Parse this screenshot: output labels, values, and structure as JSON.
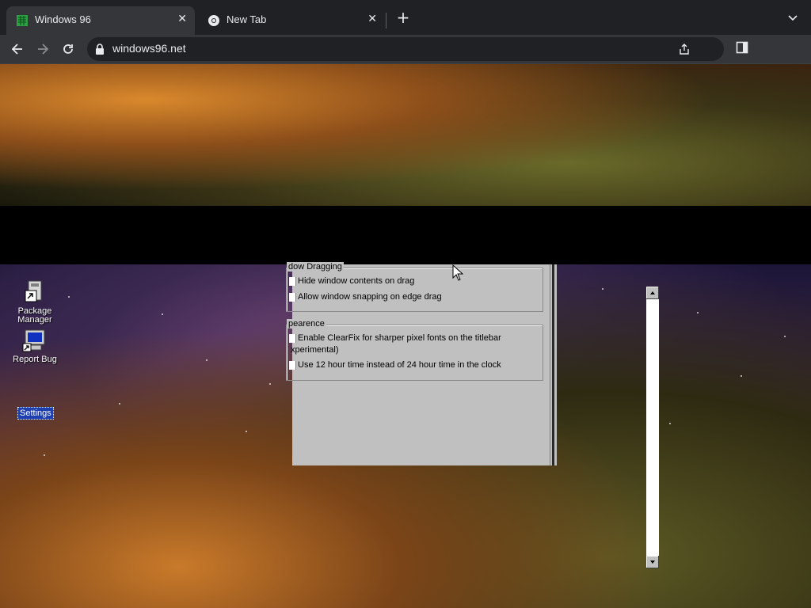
{
  "browser": {
    "tabs": [
      {
        "title": "Windows 96",
        "active": true,
        "favicon": "windows96-icon"
      },
      {
        "title": "New Tab",
        "active": false,
        "favicon": "chrome-icon"
      }
    ],
    "new_tab_label": "+",
    "url": "windows96.net"
  },
  "desktop": {
    "icons": [
      {
        "label": "Package Manager",
        "icon": "package-manager-icon"
      },
      {
        "label": "Report Bug",
        "icon": "report-bug-icon"
      },
      {
        "label": "Settings",
        "icon": "settings-icon",
        "selected": true
      }
    ]
  },
  "settings_window": {
    "groups": [
      {
        "title": "dow Dragging",
        "options": [
          {
            "label": "Hide window contents on drag"
          },
          {
            "label": "Allow window snapping on edge drag"
          }
        ]
      },
      {
        "title": "pearence",
        "options": [
          {
            "label": "Enable ClearFix for sharper pixel fonts on the titlebar",
            "label_line2": "xperimental)"
          },
          {
            "label": "Use 12 hour time instead of 24 hour time in the clock"
          }
        ]
      }
    ]
  },
  "colors": {
    "chrome_dark": "#202124",
    "chrome_toolbar": "#35363a",
    "win_face": "#c0c0c0",
    "selection": "#1d3fb0"
  }
}
